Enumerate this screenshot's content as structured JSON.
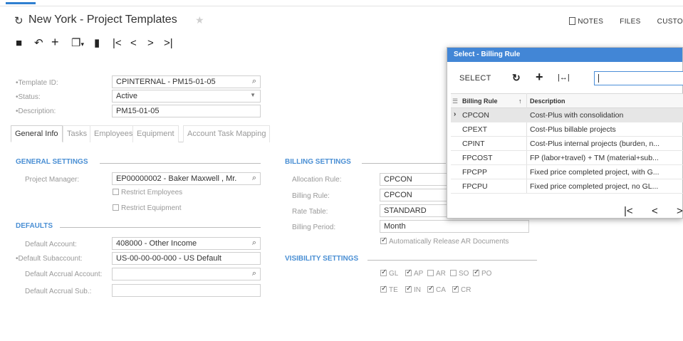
{
  "header": {
    "title": "New York - Project Templates",
    "links": [
      "NOTES",
      "FILES",
      "CUSTO"
    ]
  },
  "toolbar": {
    "icons": [
      "save-icon",
      "undo-icon",
      "add-icon",
      "copy-icon",
      "delete-icon",
      "first-icon",
      "prev-icon",
      "next-icon",
      "last-icon"
    ]
  },
  "top_form": {
    "template_id_label": "Template ID:",
    "template_id_value": "CPINTERNAL - PM15-01-05",
    "status_label": "Status:",
    "status_value": "Active",
    "description_label": "Description:",
    "description_value": "PM15-01-05"
  },
  "tabs": [
    "General Info",
    "Tasks",
    "Employees",
    "Equipment",
    "Account Task Mapping"
  ],
  "general_settings": {
    "title": "GENERAL SETTINGS",
    "project_manager_label": "Project Manager:",
    "project_manager_value": "EP00000002 - Baker Maxwell , Mr.",
    "restrict_employees": "Restrict Employees",
    "restrict_equipment": "Restrict Equipment"
  },
  "defaults": {
    "title": "DEFAULTS",
    "default_account_label": "Default Account:",
    "default_account_value": "408000 - Other Income",
    "default_subaccount_label": "Default Subaccount:",
    "default_subaccount_value": "US-00-00-00-000 - US Default",
    "default_accrual_account_label": "Default Accrual Account:",
    "default_accrual_account_value": "",
    "default_accrual_sub_label": "Default Accrual Sub.:",
    "default_accrual_sub_value": ""
  },
  "billing_settings": {
    "title": "BILLING SETTINGS",
    "allocation_rule_label": "Allocation Rule:",
    "allocation_rule_value": "CPCON",
    "billing_rule_label": "Billing Rule:",
    "billing_rule_value": "CPCON",
    "rate_table_label": "Rate Table:",
    "rate_table_value": "STANDARD",
    "billing_period_label": "Billing Period:",
    "billing_period_value": "Month",
    "auto_release": "Automatically Release AR Documents"
  },
  "visibility_settings": {
    "title": "VISIBILITY SETTINGS",
    "row1": [
      {
        "label": "GL",
        "checked": true
      },
      {
        "label": "AP",
        "checked": true
      },
      {
        "label": "AR",
        "checked": false
      },
      {
        "label": "SO",
        "checked": false
      },
      {
        "label": "PO",
        "checked": true
      }
    ],
    "row2": [
      {
        "label": "TE",
        "checked": true
      },
      {
        "label": "IN",
        "checked": true
      },
      {
        "label": "CA",
        "checked": true
      },
      {
        "label": "CR",
        "checked": true
      }
    ]
  },
  "popup": {
    "title": "Select - Billing Rule",
    "select_label": "SELECT",
    "search_value": "",
    "columns": [
      "Billing Rule",
      "Description"
    ],
    "rows": [
      {
        "rule": "CPCON",
        "desc": "Cost-Plus with consolidation",
        "selected": true
      },
      {
        "rule": "CPEXT",
        "desc": "Cost-Plus billable projects",
        "selected": false
      },
      {
        "rule": "CPINT",
        "desc": "Cost-Plus internal projects (burden, n...",
        "selected": false
      },
      {
        "rule": "FPCOST",
        "desc": "FP (labor+travel) + TM (material+sub...",
        "selected": false
      },
      {
        "rule": "FPCPP",
        "desc": "Fixed price completed project, with G...",
        "selected": false
      },
      {
        "rule": "FPCPU",
        "desc": "Fixed price completed project, no GL...",
        "selected": false
      }
    ]
  },
  "colors": {
    "accent": "#4286d6",
    "section_title": "#4a8fd4"
  }
}
